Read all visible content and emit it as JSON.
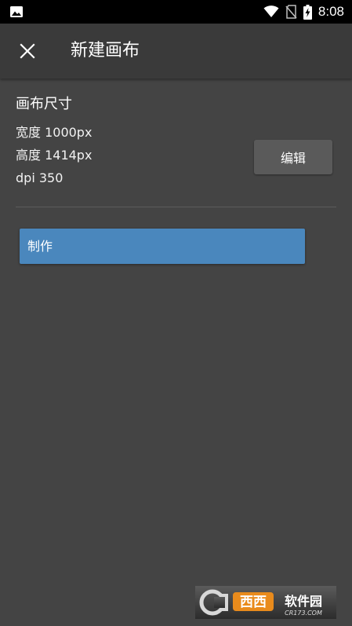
{
  "status_bar": {
    "time": "8:08",
    "left_icon": "image-icon",
    "icons": [
      "wifi-icon",
      "no-sim-icon",
      "battery-charging-icon"
    ]
  },
  "toolbar": {
    "title": "新建画布",
    "close_icon": "close-icon"
  },
  "canvas_size": {
    "heading": "画布尺寸",
    "width_text": "宽度 1000px",
    "height_text": "高度 1414px",
    "dpi_text": "dpi 350",
    "edit_label": "编辑"
  },
  "actions": {
    "make_label": "制作"
  },
  "watermark": {
    "text": "西西软件园",
    "url": "CR173.COM"
  },
  "colors": {
    "background": "#444444",
    "toolbar": "#3a3a3a",
    "primary_button": "#4a87bd",
    "secondary_button": "#5a5a5a"
  }
}
